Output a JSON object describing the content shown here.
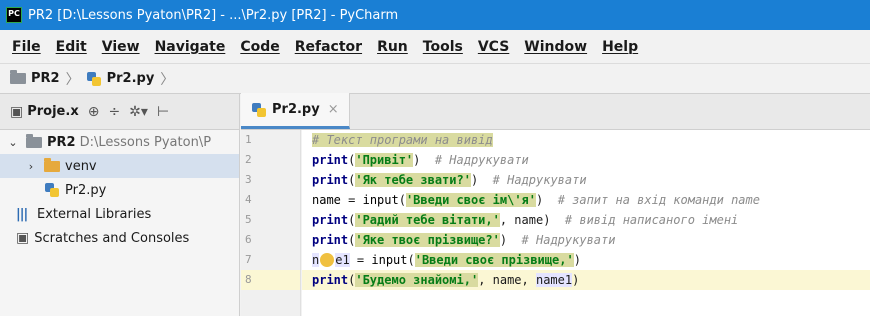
{
  "window": {
    "app_logo": "PC",
    "title": "PR2 [D:\\Lessons Pyaton\\PR2] - ...\\Pr2.py [PR2] - PyCharm"
  },
  "menu": [
    "File",
    "Edit",
    "View",
    "Navigate",
    "Code",
    "Refactor",
    "Run",
    "Tools",
    "VCS",
    "Window",
    "Help"
  ],
  "breadcrumb": {
    "project": "PR2",
    "file": "Pr2.py",
    "separator": "〉"
  },
  "project_panel": {
    "toolbar_label": "Proje.x",
    "icons": [
      "globe-icon",
      "split-icon",
      "gear-icon",
      "collapse-icon"
    ],
    "tree": [
      {
        "label": "PR2",
        "path": "D:\\Lessons Pyaton\\P",
        "type": "folder",
        "expanded": true
      },
      {
        "label": "venv",
        "type": "folder",
        "expanded": false,
        "selected": true
      },
      {
        "label": "Pr2.py",
        "type": "python-file"
      },
      {
        "label": "External Libraries",
        "type": "library"
      },
      {
        "label": "Scratches and Consoles",
        "type": "scratches"
      }
    ]
  },
  "editor": {
    "tab": {
      "label": "Pr2.py",
      "close": "×"
    },
    "current_line": 8,
    "line_numbers": [
      "1",
      "2",
      "3",
      "4",
      "5",
      "6",
      "7",
      "8"
    ],
    "code": {
      "l1_comment": "# Текст програми на вивід",
      "l2_print": "print",
      "l2_open": "(",
      "l2_str": "'Привіт'",
      "l2_close": ")",
      "l2_comment": "# Надрукувати",
      "l3_print": "print",
      "l3_open": "(",
      "l3_str": "'Як тебе звати?'",
      "l3_close": ")",
      "l3_comment": "# Надрукувати",
      "l4_name": "name",
      "l4_eq": " = ",
      "l4_input": "input",
      "l4_open": "(",
      "l4_str": "'Введи своє ім\\'я'",
      "l4_close": ")",
      "l4_comment": "# запит на вхід команди name",
      "l5_print": "print",
      "l5_open": "(",
      "l5_str": "'Радий тебе вітати,'",
      "l5_args": ", name)",
      "l5_comment": "# вивід написаного імені",
      "l6_print": "print",
      "l6_open": "(",
      "l6_str": "'Яке твоє прізвище?'",
      "l6_close": ")",
      "l6_comment": "# Надрукувати",
      "l7_name_a": "n",
      "l7_name_b": "e1",
      "l7_eq": " = ",
      "l7_input": "input",
      "l7_open": "(",
      "l7_str": "'Введи своє прізвище,'",
      "l7_close": ")",
      "l8_print": "print",
      "l8_open": "(",
      "l8_str": "'Будемо знайомі,'",
      "l8_args": ", name, ",
      "l8_var": "name1",
      "l8_close": ")"
    }
  },
  "colors": {
    "titlebar": "#1a7fd4",
    "keyword": "#000080",
    "string": "#067d17",
    "string_bg": "#d9dba0",
    "comment": "#8c8c8c",
    "current_line": "#fbf7d4"
  }
}
